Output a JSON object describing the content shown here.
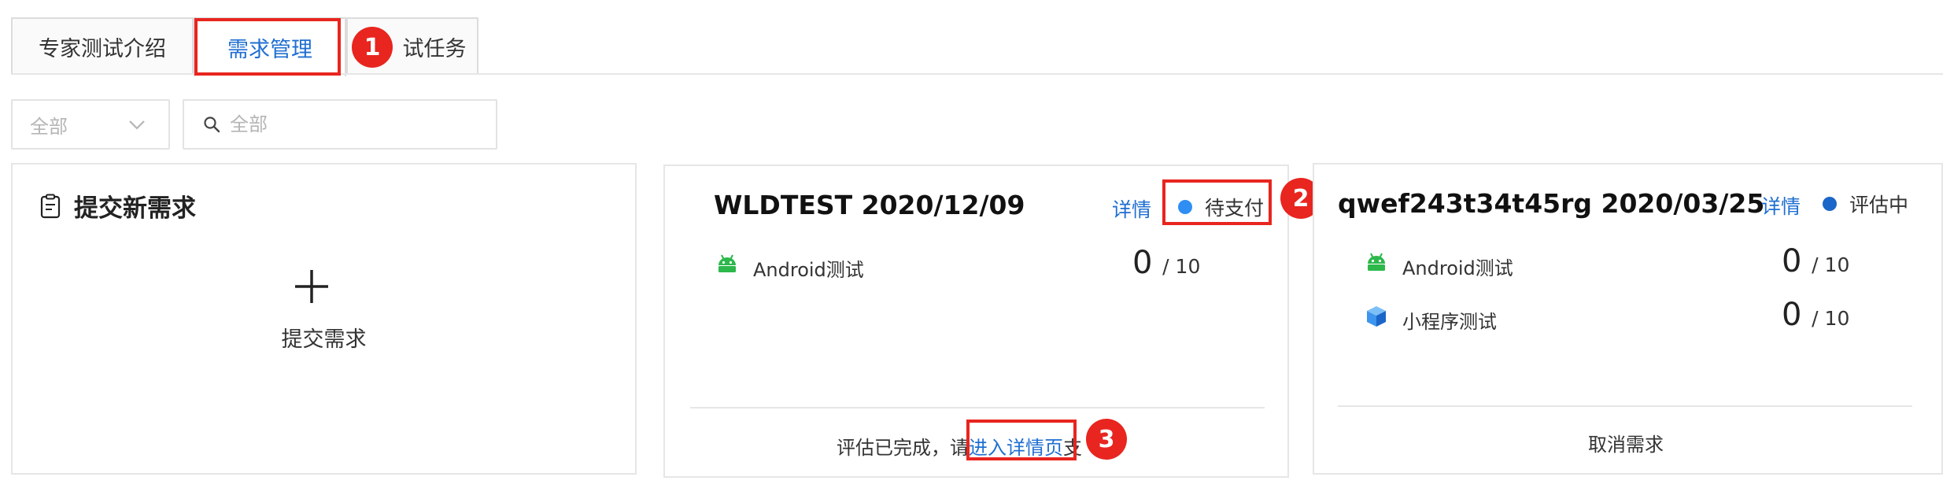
{
  "tabs": [
    {
      "label": "专家测试介绍"
    },
    {
      "label": "需求管理",
      "active": true
    },
    {
      "label": "试任务"
    }
  ],
  "annotations": [
    "1",
    "2",
    "3"
  ],
  "filters": {
    "select_value": "全部",
    "search_placeholder": "全部"
  },
  "new_card": {
    "title": "提交新需求",
    "button_label": "提交需求"
  },
  "cards": [
    {
      "title": "WLDTEST 2020/12/09",
      "detail_link": "详情",
      "status": "待支付",
      "status_color": "#2f8ef4",
      "rows": [
        {
          "icon": "android-icon",
          "label": "Android测试",
          "count": "0",
          "total": "/ 10"
        }
      ],
      "footer_prefix": "评估已完成，请",
      "footer_link": "进入详情页",
      "footer_suffix": "支"
    },
    {
      "title": "qwef243t34t45rg 2020/03/25",
      "detail_link": "详情",
      "status": "评估中",
      "status_color": "#1b66c9",
      "rows": [
        {
          "icon": "android-icon",
          "label": "Android测试",
          "count": "0",
          "total": "/ 10"
        },
        {
          "icon": "cube-icon",
          "label": "小程序测试",
          "count": "0",
          "total": "/ 10"
        }
      ],
      "footer_link": "取消需求"
    }
  ],
  "colors": {
    "accent": "#1f6fd1",
    "highlight": "#e8251f",
    "android_green": "#2db84b"
  }
}
